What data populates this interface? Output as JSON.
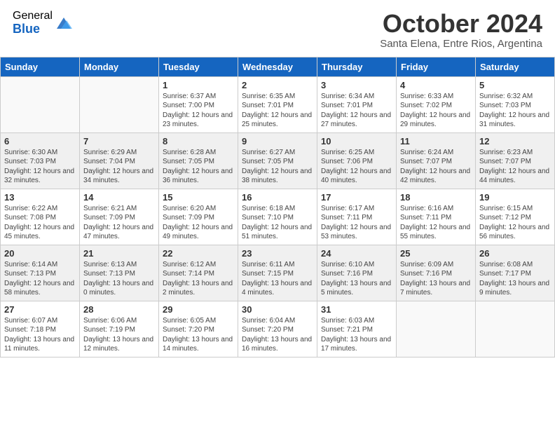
{
  "header": {
    "logo_general": "General",
    "logo_blue": "Blue",
    "month_title": "October 2024",
    "subtitle": "Santa Elena, Entre Rios, Argentina"
  },
  "days_of_week": [
    "Sunday",
    "Monday",
    "Tuesday",
    "Wednesday",
    "Thursday",
    "Friday",
    "Saturday"
  ],
  "weeks": [
    [
      {
        "day": "",
        "info": ""
      },
      {
        "day": "",
        "info": ""
      },
      {
        "day": "1",
        "info": "Sunrise: 6:37 AM\nSunset: 7:00 PM\nDaylight: 12 hours and 23 minutes."
      },
      {
        "day": "2",
        "info": "Sunrise: 6:35 AM\nSunset: 7:01 PM\nDaylight: 12 hours and 25 minutes."
      },
      {
        "day": "3",
        "info": "Sunrise: 6:34 AM\nSunset: 7:01 PM\nDaylight: 12 hours and 27 minutes."
      },
      {
        "day": "4",
        "info": "Sunrise: 6:33 AM\nSunset: 7:02 PM\nDaylight: 12 hours and 29 minutes."
      },
      {
        "day": "5",
        "info": "Sunrise: 6:32 AM\nSunset: 7:03 PM\nDaylight: 12 hours and 31 minutes."
      }
    ],
    [
      {
        "day": "6",
        "info": "Sunrise: 6:30 AM\nSunset: 7:03 PM\nDaylight: 12 hours and 32 minutes."
      },
      {
        "day": "7",
        "info": "Sunrise: 6:29 AM\nSunset: 7:04 PM\nDaylight: 12 hours and 34 minutes."
      },
      {
        "day": "8",
        "info": "Sunrise: 6:28 AM\nSunset: 7:05 PM\nDaylight: 12 hours and 36 minutes."
      },
      {
        "day": "9",
        "info": "Sunrise: 6:27 AM\nSunset: 7:05 PM\nDaylight: 12 hours and 38 minutes."
      },
      {
        "day": "10",
        "info": "Sunrise: 6:25 AM\nSunset: 7:06 PM\nDaylight: 12 hours and 40 minutes."
      },
      {
        "day": "11",
        "info": "Sunrise: 6:24 AM\nSunset: 7:07 PM\nDaylight: 12 hours and 42 minutes."
      },
      {
        "day": "12",
        "info": "Sunrise: 6:23 AM\nSunset: 7:07 PM\nDaylight: 12 hours and 44 minutes."
      }
    ],
    [
      {
        "day": "13",
        "info": "Sunrise: 6:22 AM\nSunset: 7:08 PM\nDaylight: 12 hours and 45 minutes."
      },
      {
        "day": "14",
        "info": "Sunrise: 6:21 AM\nSunset: 7:09 PM\nDaylight: 12 hours and 47 minutes."
      },
      {
        "day": "15",
        "info": "Sunrise: 6:20 AM\nSunset: 7:09 PM\nDaylight: 12 hours and 49 minutes."
      },
      {
        "day": "16",
        "info": "Sunrise: 6:18 AM\nSunset: 7:10 PM\nDaylight: 12 hours and 51 minutes."
      },
      {
        "day": "17",
        "info": "Sunrise: 6:17 AM\nSunset: 7:11 PM\nDaylight: 12 hours and 53 minutes."
      },
      {
        "day": "18",
        "info": "Sunrise: 6:16 AM\nSunset: 7:11 PM\nDaylight: 12 hours and 55 minutes."
      },
      {
        "day": "19",
        "info": "Sunrise: 6:15 AM\nSunset: 7:12 PM\nDaylight: 12 hours and 56 minutes."
      }
    ],
    [
      {
        "day": "20",
        "info": "Sunrise: 6:14 AM\nSunset: 7:13 PM\nDaylight: 12 hours and 58 minutes."
      },
      {
        "day": "21",
        "info": "Sunrise: 6:13 AM\nSunset: 7:13 PM\nDaylight: 13 hours and 0 minutes."
      },
      {
        "day": "22",
        "info": "Sunrise: 6:12 AM\nSunset: 7:14 PM\nDaylight: 13 hours and 2 minutes."
      },
      {
        "day": "23",
        "info": "Sunrise: 6:11 AM\nSunset: 7:15 PM\nDaylight: 13 hours and 4 minutes."
      },
      {
        "day": "24",
        "info": "Sunrise: 6:10 AM\nSunset: 7:16 PM\nDaylight: 13 hours and 5 minutes."
      },
      {
        "day": "25",
        "info": "Sunrise: 6:09 AM\nSunset: 7:16 PM\nDaylight: 13 hours and 7 minutes."
      },
      {
        "day": "26",
        "info": "Sunrise: 6:08 AM\nSunset: 7:17 PM\nDaylight: 13 hours and 9 minutes."
      }
    ],
    [
      {
        "day": "27",
        "info": "Sunrise: 6:07 AM\nSunset: 7:18 PM\nDaylight: 13 hours and 11 minutes."
      },
      {
        "day": "28",
        "info": "Sunrise: 6:06 AM\nSunset: 7:19 PM\nDaylight: 13 hours and 12 minutes."
      },
      {
        "day": "29",
        "info": "Sunrise: 6:05 AM\nSunset: 7:20 PM\nDaylight: 13 hours and 14 minutes."
      },
      {
        "day": "30",
        "info": "Sunrise: 6:04 AM\nSunset: 7:20 PM\nDaylight: 13 hours and 16 minutes."
      },
      {
        "day": "31",
        "info": "Sunrise: 6:03 AM\nSunset: 7:21 PM\nDaylight: 13 hours and 17 minutes."
      },
      {
        "day": "",
        "info": ""
      },
      {
        "day": "",
        "info": ""
      }
    ]
  ]
}
